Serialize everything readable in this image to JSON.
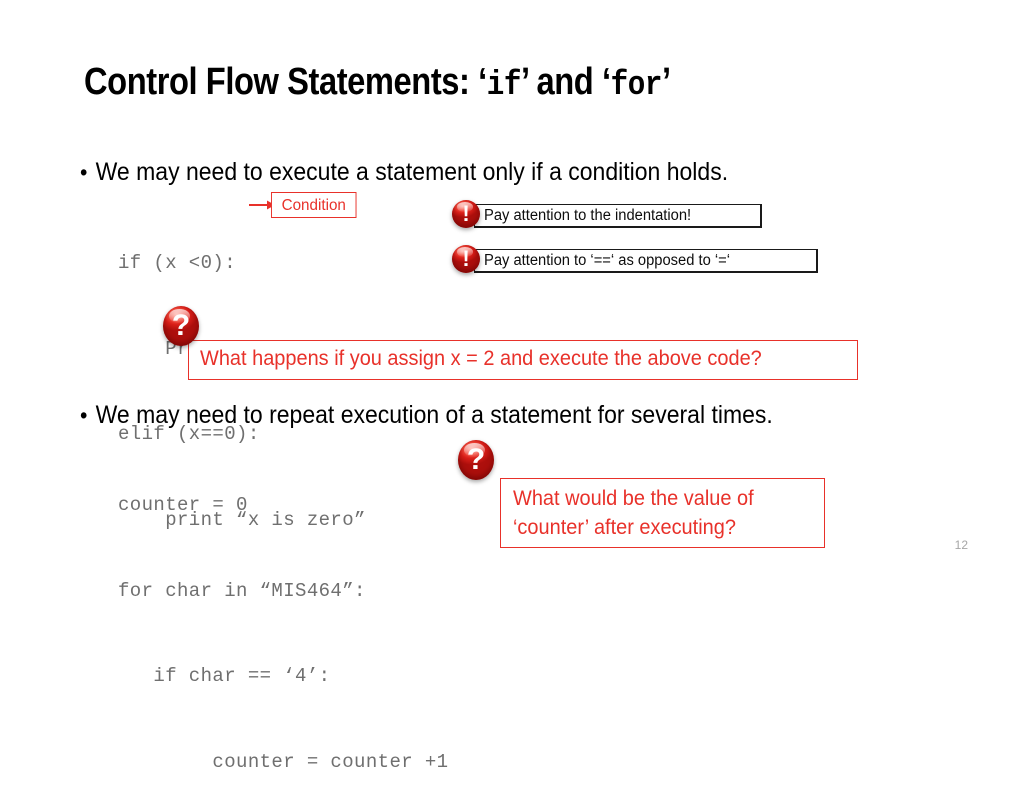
{
  "slide": {
    "title_prefix": "Control Flow Statements: ",
    "title_kw1": "if",
    "title_kw2": "for",
    "title_quote_open": "‘",
    "title_quote_close": "’",
    "title_conj": " and ",
    "page_number": "12",
    "background_color": "#ffffff",
    "accent_red": "#e8312a",
    "code_gray": "#6f6f6f"
  },
  "bullets": [
    {
      "marker": "•",
      "text": "We may need to execute a statement only if a condition holds."
    },
    {
      "marker": "•",
      "text": "We may need to repeat execution of a statement for several times."
    }
  ],
  "code_blocks": [
    {
      "id": "if-example",
      "lines": [
        "if (x <0):",
        "    Print “x is negative”",
        "elif (x==0):",
        "    print “x is zero”"
      ]
    },
    {
      "id": "for-example",
      "lines": [
        "counter = 0",
        "for char in “MIS464”:",
        "   if char == ‘4’:",
        "        counter = counter +1"
      ]
    }
  ],
  "annotations": {
    "condition_label": "Condition",
    "warnings": [
      {
        "icon": "exclamation-icon",
        "glyph": "!",
        "text": "Pay attention to the indentation!"
      },
      {
        "icon": "exclamation-icon",
        "glyph": "!",
        "text": "Pay attention to ‘==‘ as opposed to ‘=‘"
      }
    ],
    "questions": [
      {
        "icon": "question-icon",
        "glyph": "?",
        "text": "What happens if you assign x = 2 and execute the above code?"
      },
      {
        "icon": "question-icon",
        "glyph": "?",
        "line1": "What would be the value of",
        "line2": "‘counter’ after executing?"
      }
    ]
  }
}
